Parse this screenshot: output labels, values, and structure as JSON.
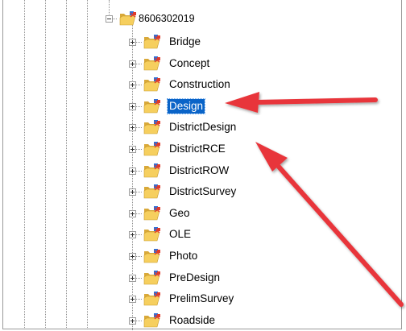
{
  "tree": {
    "root": {
      "label": "8606302019",
      "icon": "folder-project-icon",
      "expanded": true
    },
    "children": [
      {
        "label": "Bridge",
        "selected": false
      },
      {
        "label": "Concept",
        "selected": false
      },
      {
        "label": "Construction",
        "selected": false
      },
      {
        "label": "Design",
        "selected": true
      },
      {
        "label": "DistrictDesign",
        "selected": false
      },
      {
        "label": "DistrictRCE",
        "selected": false
      },
      {
        "label": "DistrictROW",
        "selected": false
      },
      {
        "label": "DistrictSurvey",
        "selected": false
      },
      {
        "label": "Geo",
        "selected": false
      },
      {
        "label": "OLE",
        "selected": false
      },
      {
        "label": "Photo",
        "selected": false
      },
      {
        "label": "PreDesign",
        "selected": false
      },
      {
        "label": "PrelimSurvey",
        "selected": false
      },
      {
        "label": "Roadside",
        "selected": false
      }
    ]
  },
  "colors": {
    "selection": "#0a64c8",
    "arrow": "#e8363a",
    "folder": "#f2c14e",
    "badge_blue": "#2f6fd6",
    "badge_red": "#e03a2a"
  }
}
